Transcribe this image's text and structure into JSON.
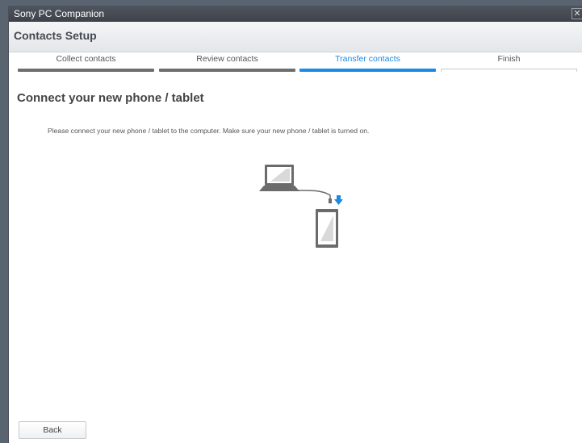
{
  "window": {
    "title": "Sony PC Companion",
    "close_glyph": "✕"
  },
  "header": {
    "title": "Contacts Setup"
  },
  "steps": [
    {
      "label": "Collect contacts",
      "state": "done"
    },
    {
      "label": "Review contacts",
      "state": "done"
    },
    {
      "label": "Transfer contacts",
      "state": "active"
    },
    {
      "label": "Finish",
      "state": "pending"
    }
  ],
  "main": {
    "heading": "Connect your new phone / tablet",
    "instruction": "Please connect your new phone / tablet to the computer. Make sure your new phone / tablet is turned on.",
    "illustration_icons": [
      "laptop-icon",
      "usb-cable-icon",
      "download-arrow-icon",
      "phone-icon"
    ]
  },
  "footer": {
    "back_label": "Back"
  },
  "colors": {
    "accent": "#1a8ae6",
    "progress_done": "#6e6e6e",
    "titlebar": "#474c55"
  }
}
